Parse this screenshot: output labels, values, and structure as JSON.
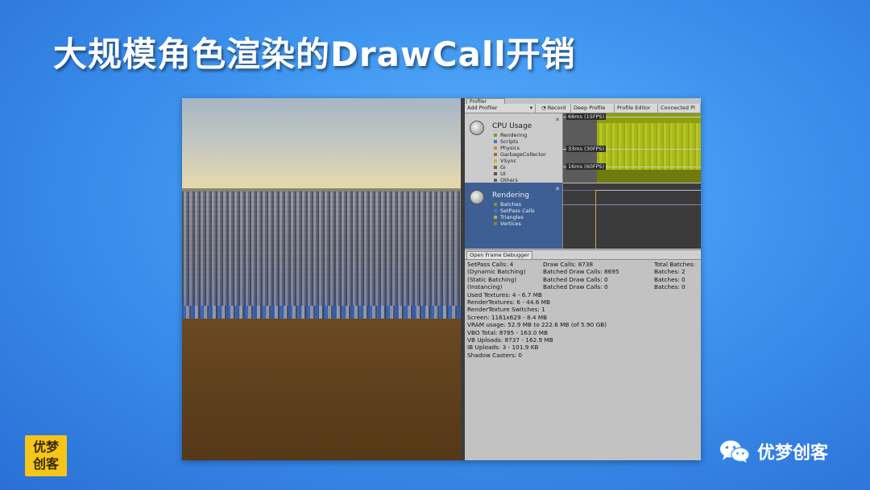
{
  "title": "大规模角色渲染的DrawCall开销",
  "profiler": {
    "tab_label": "Profiler",
    "toolbar": {
      "add_profiler": "Add Profiler",
      "record": "Record",
      "deep_profile": "Deep Profile",
      "profile_editor": "Profile Editor",
      "connected": "Connected Pl"
    },
    "cpu_area": {
      "title": "CPU Usage",
      "legend": [
        {
          "label": "Rendering",
          "color": "#7a9a2a"
        },
        {
          "label": "Scripts",
          "color": "#3a7ac8"
        },
        {
          "label": "Physics",
          "color": "#c88a2a"
        },
        {
          "label": "GarbageCollector",
          "color": "#a07040"
        },
        {
          "label": "VSync",
          "color": "#c8b830"
        },
        {
          "label": "Gi",
          "color": "#806040"
        },
        {
          "label": "UI",
          "color": "#505050"
        },
        {
          "label": "Others",
          "color": "#606060"
        }
      ],
      "graph_labels": [
        "66ms (15FPS)",
        "33ms (30FPS)",
        "16ms (60FPS)"
      ]
    },
    "rendering_area": {
      "title": "Rendering",
      "legend": [
        {
          "label": "Batches",
          "color": "#7a9a2a"
        },
        {
          "label": "SetPass Calls",
          "color": "#3a7ac8"
        },
        {
          "label": "Triangles",
          "color": "#c8a830"
        },
        {
          "label": "Vertices",
          "color": "#a07040"
        }
      ]
    },
    "open_frame_debugger": "Open Frame Debugger",
    "stats": {
      "rows3": [
        [
          "SetPass Calls: 4",
          "Draw Calls: 8738",
          "Total Batches:"
        ],
        [
          "(Dynamic Batching)",
          "Batched Draw Calls: 8695",
          "Batches: 2"
        ],
        [
          "(Static Batching)",
          "Batched Draw Calls: 0",
          "Batches: 0"
        ],
        [
          "(Instancing)",
          "Batched Draw Calls: 0",
          "Batches: 0"
        ]
      ],
      "lines": [
        "Used Textures: 4 - 6.7 MB",
        "RenderTextures: 6 - 44.6 MB",
        "RenderTexture Switches: 1",
        "Screen: 1161x629 - 8.4 MB",
        "VRAM usage: 52.9 MB to 222.6 MB (of 5.90 GB)",
        "VBO Total: 8785 - 163.0 MB",
        "VB Uploads: 8737 - 162.9 MB",
        "IB Uploads: 3 - 101.9 KB",
        "Shadow Casters: 0"
      ]
    }
  },
  "logo_badge": {
    "line1": "优梦",
    "line2": "创客"
  },
  "brand": {
    "name": "优梦创客",
    "icon": "wechat-icon"
  }
}
